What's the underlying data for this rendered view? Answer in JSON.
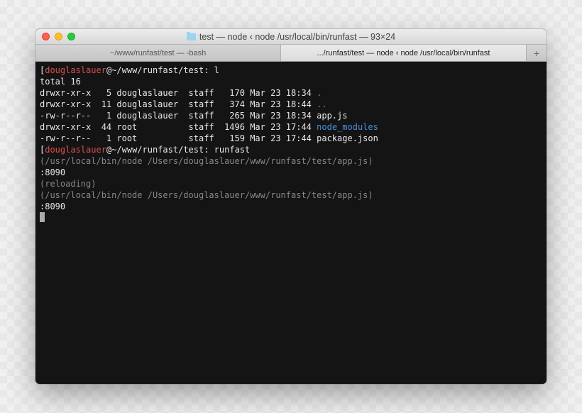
{
  "window": {
    "title_folder": "test",
    "title_rest": " — node ‹ node /usr/local/bin/runfast — 93×24"
  },
  "tabs": [
    {
      "label": "~/www/runfast/test — -bash"
    },
    {
      "label": ".../runfast/test — node ‹ node /usr/local/bin/runfast"
    }
  ],
  "tab_add": "+",
  "prompt": {
    "user": "douglaslauer",
    "at": "@",
    "path": "~/www/runfast/test",
    "sep": ": "
  },
  "cmd1": "l",
  "ls": {
    "total": "total 16",
    "rows": [
      {
        "perm": "drwxr-xr-x",
        "n": " 5",
        "own": "douglaslauer",
        "grp": "staff",
        "size": " 170",
        "date": "Mar 23 18:34",
        "name": ".",
        "dir": true
      },
      {
        "perm": "drwxr-xr-x",
        "n": "11",
        "own": "douglaslauer",
        "grp": "staff",
        "size": " 374",
        "date": "Mar 23 18:44",
        "name": "..",
        "dir": true
      },
      {
        "perm": "-rw-r--r--",
        "n": " 1",
        "own": "douglaslauer",
        "grp": "staff",
        "size": " 265",
        "date": "Mar 23 18:34",
        "name": "app.js",
        "dir": false
      },
      {
        "perm": "drwxr-xr-x",
        "n": "44",
        "own": "root        ",
        "grp": "staff",
        "size": "1496",
        "date": "Mar 23 17:44",
        "name": "node_modules",
        "dir": true
      },
      {
        "perm": "-rw-r--r--",
        "n": " 1",
        "own": "root        ",
        "grp": "staff",
        "size": " 159",
        "date": "Mar 23 17:44",
        "name": "package.json",
        "dir": false
      }
    ]
  },
  "cmd2": "runfast",
  "out": {
    "proc1": "(/usr/local/bin/node /Users/douglaslauer/www/runfast/test/app.js)",
    "port1": ":8090",
    "reload": "(reloading)",
    "proc2": "(/usr/local/bin/node /Users/douglaslauer/www/runfast/test/app.js)",
    "port2": ":8090"
  }
}
